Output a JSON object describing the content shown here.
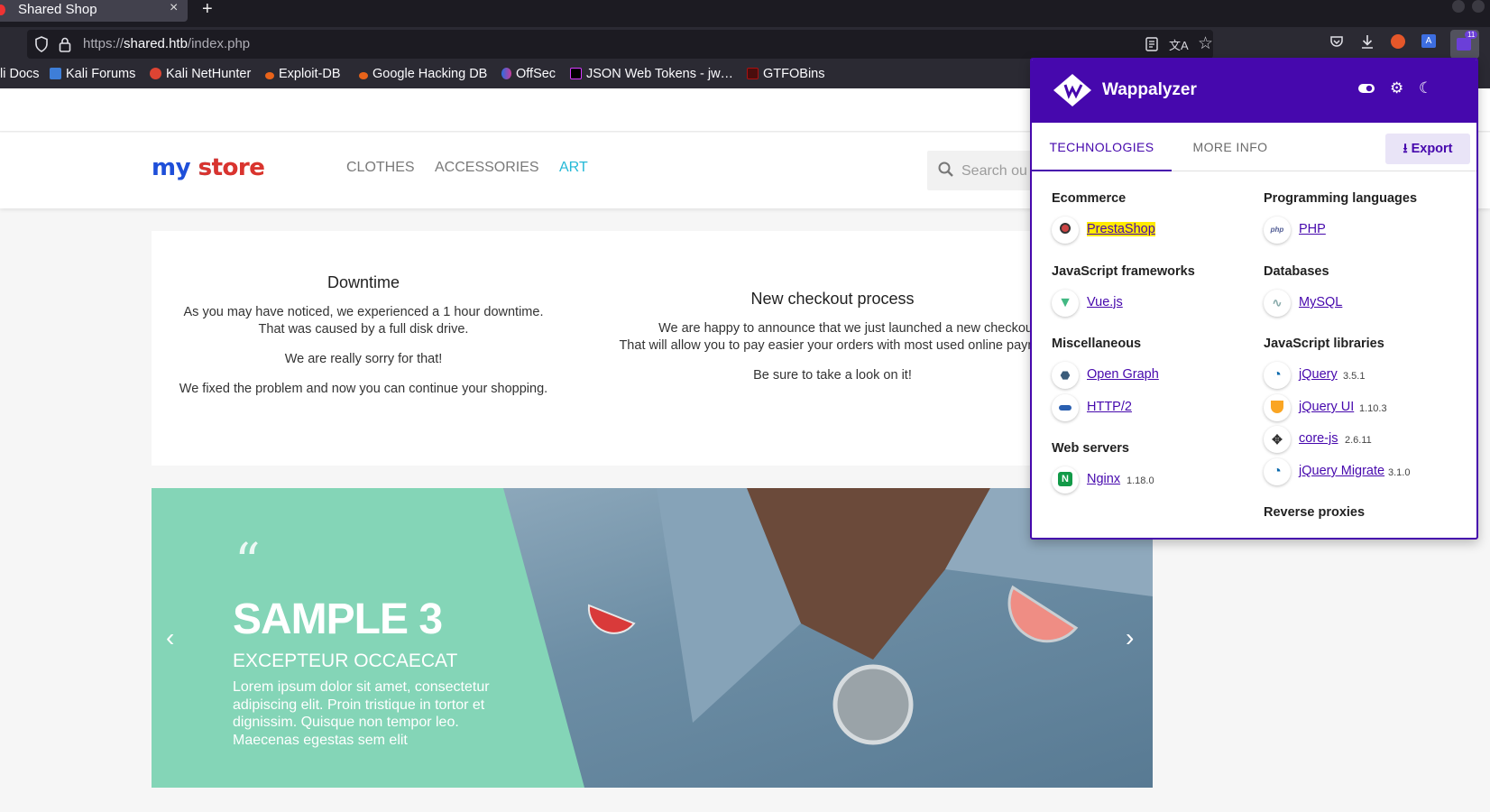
{
  "browser": {
    "tab_title": "Shared Shop",
    "url_prefix": "https://",
    "url_host": "shared.htb",
    "url_path": "/index.php",
    "extension_badge": "11",
    "bookmarks": [
      "li Docs",
      "Kali Forums",
      "Kali NetHunter",
      "Exploit-DB",
      "Google Hacking DB",
      "OffSec",
      "JSON Web Tokens - jw…",
      "GTFOBins"
    ]
  },
  "store": {
    "logo_my": "my",
    "logo_store": "store",
    "nav": [
      "CLOTHES",
      "ACCESSORIES",
      "ART"
    ],
    "search_placeholder": "Search ou"
  },
  "cards": {
    "downtime": {
      "title": "Downtime",
      "p1a": "As you may have noticed, we experienced a 1 hour downtime.",
      "p1b": "That was caused by a full disk drive.",
      "p2": "We are really sorry for that!",
      "p3": "We fixed the problem and now you can continue your shopping."
    },
    "checkout": {
      "title": "New checkout process",
      "p1a": "We are happy to announce that we just launched a new checkout pr",
      "p1b": "That will allow you to pay easier your orders with most used online payme",
      "p2": "Be sure to take a look on it!"
    }
  },
  "slider": {
    "quote_mark": "“",
    "title": "SAMPLE 3",
    "subtitle": "EXCEPTEUR OCCAECAT",
    "body": "Lorem ipsum dolor sit amet, consectetur adipiscing elit. Proin tristique in tortor et dignissim. Quisque non tempor leo. Maecenas egestas sem elit",
    "prev_arrow": "‹",
    "next_arrow": "›",
    "accent_color": "#84d5b7"
  },
  "wappalyzer": {
    "name": "Wappalyzer",
    "tab_technologies": "TECHNOLOGIES",
    "tab_more_info": "MORE INFO",
    "export_label": "Export",
    "brand_color": "#4608ad",
    "categories": {
      "ecommerce": "Ecommerce",
      "programming": "Programming languages",
      "js_frameworks": "JavaScript frameworks",
      "databases": "Databases",
      "misc": "Miscellaneous",
      "js_libraries": "JavaScript libraries",
      "web_servers": "Web servers",
      "reverse_proxies": "Reverse proxies"
    },
    "tech": {
      "prestashop": {
        "name": "PrestaShop",
        "version": ""
      },
      "php": {
        "name": "PHP",
        "version": "",
        "icon_text": "php"
      },
      "vue": {
        "name": "Vue.js",
        "version": ""
      },
      "mysql": {
        "name": "MySQL",
        "version": ""
      },
      "opengraph": {
        "name": "Open Graph",
        "version": ""
      },
      "http2": {
        "name": "HTTP/2",
        "version": ""
      },
      "jquery": {
        "name": "jQuery",
        "version": "3.5.1"
      },
      "jqueryui": {
        "name": "jQuery UI",
        "version": "1.10.3"
      },
      "corejs": {
        "name": "core-js",
        "version": "2.6.11"
      },
      "jquerymigrate": {
        "name": "jQuery Migrate",
        "version": "3.1.0"
      },
      "nginx": {
        "name": "Nginx",
        "version": "1.18.0",
        "icon_text": "N"
      }
    }
  }
}
